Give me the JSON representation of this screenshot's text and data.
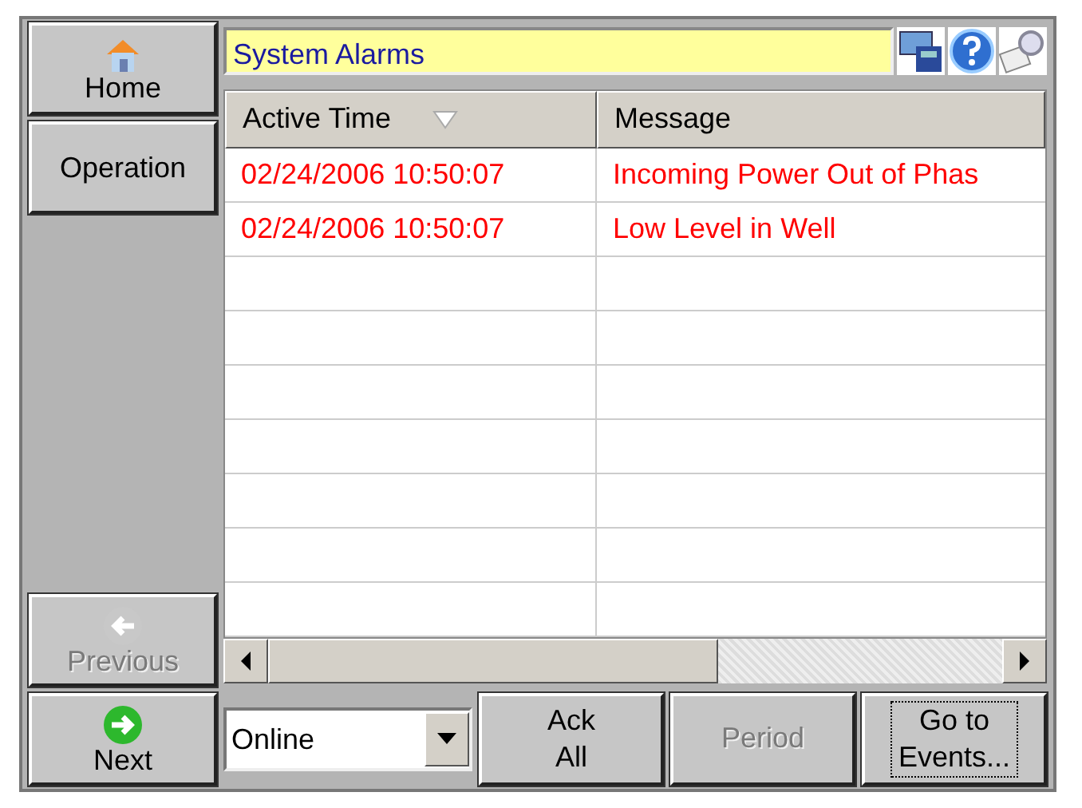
{
  "nav": [
    {
      "kind": "home",
      "label": "Home",
      "disabled": false
    },
    {
      "kind": "plain",
      "label": "Operation",
      "disabled": false
    }
  ],
  "nav_bottom": [
    {
      "kind": "previous",
      "label": "Previous",
      "disabled": true
    },
    {
      "kind": "next",
      "label": "Next",
      "disabled": false
    }
  ],
  "title": "System Alarms",
  "table": {
    "columns": [
      {
        "label": "Active Time",
        "sorted": true
      },
      {
        "label": "Message",
        "sorted": false
      }
    ],
    "rows": [
      {
        "cells": [
          "02/24/2006 10:50:07",
          "Incoming Power Out of Phas"
        ]
      },
      {
        "cells": [
          "02/24/2006 10:50:07",
          "Low Level in Well"
        ]
      }
    ]
  },
  "filter": {
    "value": "Online"
  },
  "buttons": [
    {
      "label": "Ack\nAll",
      "disabled": false,
      "focused": false
    },
    {
      "label": "Period",
      "disabled": true,
      "focused": false
    },
    {
      "label": "Go to\nEvents...",
      "disabled": false,
      "focused": true
    }
  ]
}
